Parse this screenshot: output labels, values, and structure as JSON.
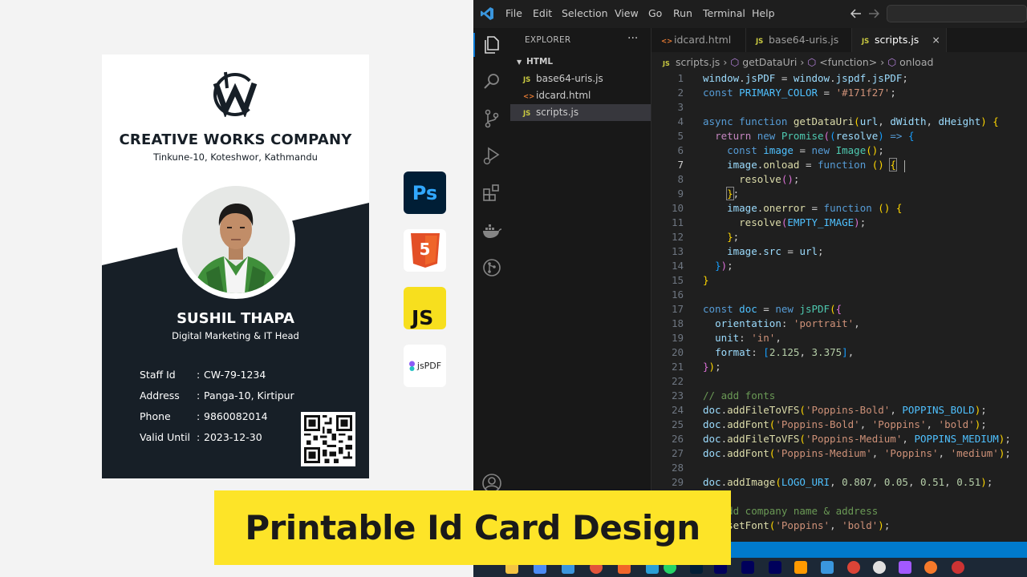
{
  "card": {
    "company": "CREATIVE WORKS COMPANY",
    "address": "Tinkune-10, Koteshwor, Kathmandu",
    "name": "SUSHIL THAPA",
    "role": "Digital Marketing & IT Head",
    "fields": [
      {
        "label": "Staff Id",
        "value": "CW-79-1234"
      },
      {
        "label": "Address",
        "value": "Panga-10, Kirtipur"
      },
      {
        "label": "Phone",
        "value": "9860082014"
      },
      {
        "label": "Valid Until",
        "value": "2023-12-30"
      }
    ],
    "separator": ":",
    "colors": {
      "primary": "#171f27"
    }
  },
  "tools": [
    {
      "label": "Ps",
      "icon": "photoshop-icon"
    },
    {
      "label": "5",
      "icon": "html5-icon"
    },
    {
      "label": "JS",
      "icon": "javascript-icon"
    },
    {
      "label": "jsPDF",
      "icon": "jspdf-icon"
    }
  ],
  "vscode": {
    "menu": [
      "File",
      "Edit",
      "Selection",
      "View",
      "Go",
      "Run",
      "Terminal",
      "Help"
    ],
    "explorer_title": "EXPLORER",
    "explorer_more": "···",
    "folder": "HTML",
    "files": [
      {
        "name": "base64-uris.js",
        "type": "JS"
      },
      {
        "name": "idcard.html",
        "type": "<>"
      },
      {
        "name": "scripts.js",
        "type": "JS"
      }
    ],
    "tabs": [
      {
        "name": "idcard.html",
        "type": "<>"
      },
      {
        "name": "base64-uris.js",
        "type": "JS"
      },
      {
        "name": "scripts.js",
        "type": "JS",
        "close": "×"
      }
    ],
    "breadcrumbs": [
      "scripts.js",
      "getDataUri",
      "<function>",
      "onload"
    ],
    "current_line": 7,
    "accent": "#007acc"
  },
  "banner": {
    "text": "Printable Id Card Design",
    "color": "#fde428"
  }
}
